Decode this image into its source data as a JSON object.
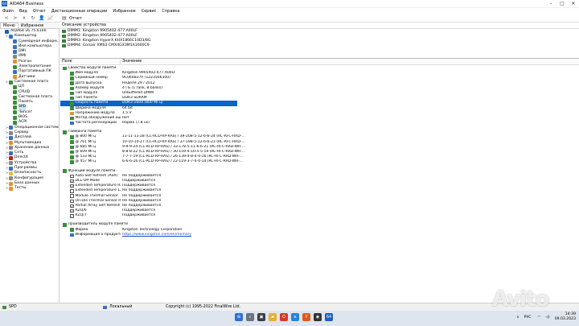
{
  "window": {
    "title": "AIDA64 Business",
    "logo_text": "64"
  },
  "menu": [
    "Файл",
    "Вид",
    "Отчет",
    "Дистанционные операции",
    "Избранное",
    "Сервис",
    "Справка"
  ],
  "toolbar": {
    "report_label": "Отчет"
  },
  "tabs": [
    "Меню",
    "Избранное"
  ],
  "tree": [
    {
      "label": "AIDA64 v6.75.6100",
      "level": 0,
      "exp": "",
      "icon": "#1f5fb6"
    },
    {
      "label": "Компьютер",
      "level": 1,
      "exp": "∨",
      "icon": "#3a6fc4"
    },
    {
      "label": "Суммарная информ...",
      "level": 2,
      "exp": "",
      "icon": "#3a6fc4"
    },
    {
      "label": "Имя компьютера",
      "level": 2,
      "exp": "",
      "icon": "#3a6fc4"
    },
    {
      "label": "DMI",
      "level": 2,
      "exp": "",
      "icon": "#3a6fc4"
    },
    {
      "label": "IPMI",
      "level": 2,
      "exp": "",
      "icon": "#888"
    },
    {
      "label": "Разгон",
      "level": 2,
      "exp": "",
      "icon": "#e3922c"
    },
    {
      "label": "Электропитание",
      "level": 2,
      "exp": "",
      "icon": "#3c8d3c"
    },
    {
      "label": "Портативный ПК",
      "level": 2,
      "exp": "",
      "icon": "#3a6fc4"
    },
    {
      "label": "Датчики",
      "level": 2,
      "exp": "",
      "icon": "#e3922c"
    },
    {
      "label": "Системная плата",
      "level": 1,
      "exp": "∨",
      "icon": "#3c8d3c"
    },
    {
      "label": "ЦП",
      "level": 2,
      "exp": "",
      "icon": "#3c8d3c"
    },
    {
      "label": "CPUID",
      "level": 2,
      "exp": "",
      "icon": "#3c8d3c"
    },
    {
      "label": "Системная плата",
      "level": 2,
      "exp": "",
      "icon": "#3c8d3c"
    },
    {
      "label": "Память",
      "level": 2,
      "exp": "",
      "icon": "#3c8d3c"
    },
    {
      "label": "SPD",
      "level": 2,
      "exp": "",
      "icon": "#3c8d3c",
      "selected": true
    },
    {
      "label": "Чипсет",
      "level": 2,
      "exp": "",
      "icon": "#3c8d3c"
    },
    {
      "label": "BIOS",
      "level": 2,
      "exp": "",
      "icon": "#3c8d3c"
    },
    {
      "label": "ACPI",
      "level": 2,
      "exp": "",
      "icon": "#3c8d3c"
    },
    {
      "label": "Операционная система",
      "level": 1,
      "exp": ">",
      "icon": "#3a6fc4"
    },
    {
      "label": "Сервер",
      "level": 1,
      "exp": ">",
      "icon": "#888"
    },
    {
      "label": "Дисплей",
      "level": 1,
      "exp": ">",
      "icon": "#3a6fc4"
    },
    {
      "label": "Мультимедиа",
      "level": 1,
      "exp": ">",
      "icon": "#e3922c"
    },
    {
      "label": "Хранение данных",
      "level": 1,
      "exp": ">",
      "icon": "#888"
    },
    {
      "label": "Сеть",
      "level": 1,
      "exp": ">",
      "icon": "#3a6fc4"
    },
    {
      "label": "DirectX",
      "level": 1,
      "exp": ">",
      "icon": "#c02020"
    },
    {
      "label": "Устройства",
      "level": 1,
      "exp": ">",
      "icon": "#888"
    },
    {
      "label": "Программы",
      "level": 1,
      "exp": ">",
      "icon": "#3a6fc4"
    },
    {
      "label": "Безопасность",
      "level": 1,
      "exp": ">",
      "icon": "#e5c030"
    },
    {
      "label": "Конфигурация",
      "level": 1,
      "exp": ">",
      "icon": "#888"
    },
    {
      "label": "База данных",
      "level": 1,
      "exp": ">",
      "icon": "#e3922c"
    },
    {
      "label": "Тесты",
      "level": 1,
      "exp": ">",
      "icon": "#e3922c"
    }
  ],
  "device_header": "Описание устройства",
  "devices": [
    "DIMM1: Kingston 9905402-477.A00LF",
    "DIMM2: Kingston 9905402-477.A00LF",
    "DIMM3: Kingston HyperX KHX1866C10D3/8G",
    "DIMM4: Corsair XMS3 CMX4GX3M1A1600C9"
  ],
  "columns": {
    "field": "Поле",
    "value": "Значение"
  },
  "rows": [
    {
      "type": "section",
      "f": "Свойства модуля памяти",
      "icon": "ic-green"
    },
    {
      "type": "row",
      "f": "Имя модуля",
      "v": "Kingston 9905402-477.A00LF",
      "icon": "ic-green"
    },
    {
      "type": "row",
      "f": "Серийный номер",
      "v": "9C064B37h (1223566300)",
      "icon": "ic-green"
    },
    {
      "type": "row",
      "f": "Дата выпуска",
      "v": "Неделя 29 / 2012",
      "icon": "ic-green"
    },
    {
      "type": "row",
      "f": "Размер модуля",
      "v": "4 ГБ (1 rank, 8 banks)",
      "icon": "ic-green"
    },
    {
      "type": "row",
      "f": "Тип модуля",
      "v": "Unbuffered DIMM",
      "icon": "ic-green"
    },
    {
      "type": "row",
      "f": "Тип памяти",
      "v": "DDR3 SDRAM",
      "icon": "ic-green"
    },
    {
      "type": "row",
      "f": "Скорость памяти",
      "v": "DDR3-1600 (800 МГц)",
      "icon": "ic-green",
      "selected": true
    },
    {
      "type": "row",
      "f": "Ширина модуля",
      "v": "64 bit",
      "icon": "ic-green"
    },
    {
      "type": "row",
      "f": "Напряжение модуля",
      "v": "1.5 V",
      "icon": "ic-orange"
    },
    {
      "type": "row",
      "f": "Метод обнаружения ошибок",
      "v": "Нет",
      "icon": "ic-green"
    },
    {
      "type": "row",
      "f": "Частота регенерации",
      "v": "Норма (7.8 us)",
      "icon": "ic-blue"
    },
    {
      "type": "gap"
    },
    {
      "type": "section",
      "f": "Тайминги памяти",
      "icon": "ic-green"
    },
    {
      "type": "row",
      "f": "@ 800 МГц",
      "v": "11-11-11-28  (CL-RCD-RP-RAS) / 39-208-5-12-6-6-24  (RC-RFC-RRD-...",
      "icon": "ic-green"
    },
    {
      "type": "row",
      "f": "@ 761 МГц",
      "v": "10-10-10-27  (CL-RCD-RP-RAS) / 37-198-5-12-6-6-23  (RC-RFC-RRD-...",
      "icon": "ic-green"
    },
    {
      "type": "row",
      "f": "@ 685 МГц",
      "v": "9-9-9-24  (CL-RCD-RP-RAS) / 33-178-5-11-6-6-21  (RC-RFC-RRD-WR-...",
      "icon": "ic-green"
    },
    {
      "type": "row",
      "f": "@ 609 МГц",
      "v": "8-8-8-22  (CL-RCD-RP-RAS) / 30-159-4-10-5-5-19  (RC-RFC-RRD-WR-...",
      "icon": "ic-green"
    },
    {
      "type": "row",
      "f": "@ 533 МГц",
      "v": "7-7-7-19  (CL-RCD-RP-RAS) / 26-139-4-8-4-4-16  (RC-RFC-RRD-WR-...",
      "icon": "ic-green"
    },
    {
      "type": "row",
      "f": "@ 457 МГц",
      "v": "6-6-6-16  (CL-RCD-RP-RAS) / 22-119-3-7-4-4-14  (RC-RFC-RRD-WR-...",
      "icon": "ic-green"
    },
    {
      "type": "gap"
    },
    {
      "type": "section",
      "f": "Функции модуля памяти",
      "icon": "ic-green"
    },
    {
      "type": "check",
      "f": "Auto Self Refresh (ASR)",
      "v": "Не поддерживается",
      "checked": false
    },
    {
      "type": "check",
      "f": "DLL-Off Mode",
      "v": "Поддерживается",
      "checked": true
    },
    {
      "type": "check",
      "f": "Extended Temperature Range",
      "v": "Поддерживается",
      "checked": true
    },
    {
      "type": "check",
      "f": "Extended Temperature 1X Re...",
      "v": "Не поддерживается",
      "checked": false
    },
    {
      "type": "check",
      "f": "Module Thermal Sensor",
      "v": "Не поддерживается",
      "checked": false
    },
    {
      "type": "check",
      "f": "On-Die Thermal Sensor Read...",
      "v": "Не поддерживается",
      "checked": false
    },
    {
      "type": "check",
      "f": "Partial Array Self Refresh (...",
      "v": "Не поддерживается",
      "checked": true
    },
    {
      "type": "check",
      "f": "RZQ/6",
      "v": "Поддерживается",
      "checked": true
    },
    {
      "type": "check",
      "f": "RZQ/7",
      "v": "Поддерживается",
      "checked": true
    },
    {
      "type": "gap"
    },
    {
      "type": "section",
      "f": "Производитель модуля памяти",
      "icon": "ic-green"
    },
    {
      "type": "row",
      "f": "Фирма",
      "v": "Kingston Technology Corporation",
      "icon": "ic-green"
    },
    {
      "type": "link",
      "f": "Информация о продукте",
      "v": "https://www.kingston.com/en/memory",
      "icon": "ic-blue"
    }
  ],
  "status": {
    "left": "SPD",
    "mid": "Локальный",
    "right": "Copyright (c) 1995-2022 FinalWire Ltd."
  },
  "taskbar": {
    "lang": "РУС",
    "time": "14:39",
    "date": "09.03.2023"
  },
  "watermark": "Avito"
}
